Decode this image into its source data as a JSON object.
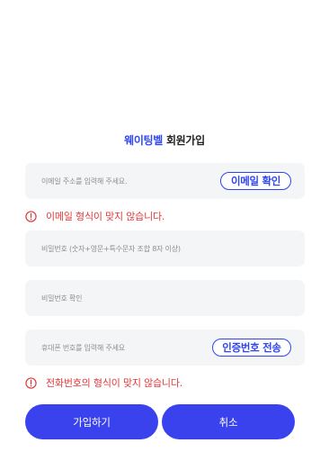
{
  "title": {
    "brand": "웨이팅벨",
    "text": "회원가입"
  },
  "email": {
    "placeholder": "이메일 주소를 입력해 주세요.",
    "verify_button": "이메일 확인",
    "error": "이메일 형식이 맞지 않습니다."
  },
  "password": {
    "placeholder": "비밀번호 (숫자+영문+특수문자 조합 8자 이상)"
  },
  "password_confirm": {
    "placeholder": "비밀번호 확인"
  },
  "phone": {
    "placeholder": "휴대폰 번호를 입력해 주세요",
    "send_button": "인증번호 전송",
    "error": "전화번호의 형식이 맞지 않습니다."
  },
  "actions": {
    "signup": "가입하기",
    "cancel": "취소"
  },
  "colors": {
    "accent": "#2f45f2",
    "button": "#3a42ee",
    "error": "#e23a3a",
    "field_bg": "#f4f5f7"
  },
  "icons": {
    "error": "alert-circle-icon"
  }
}
